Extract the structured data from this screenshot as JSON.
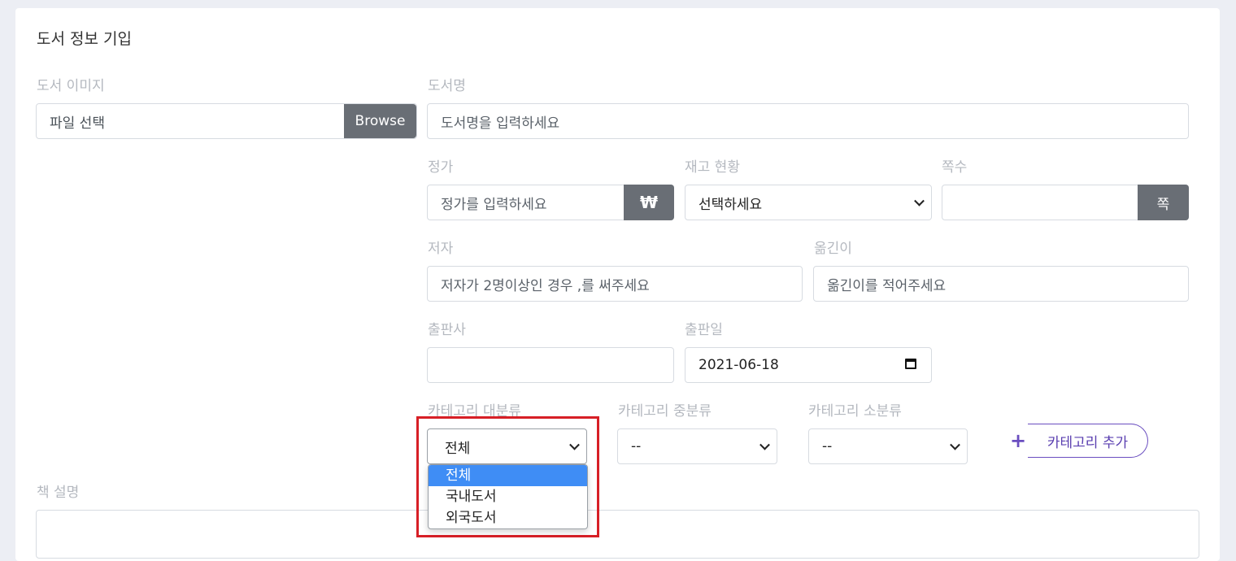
{
  "form": {
    "title": "도서 정보 기입",
    "image": {
      "label": "도서 이미지",
      "value": "파일 선택",
      "button": "Browse"
    },
    "book_name": {
      "label": "도서명",
      "placeholder": "도서명을 입력하세요"
    },
    "price": {
      "label": "정가",
      "placeholder": "정가를 입력하세요",
      "addon": "₩"
    },
    "stock": {
      "label": "재고 현황",
      "selected": "선택하세요"
    },
    "pages": {
      "label": "쪽수",
      "value": "",
      "addon": "쪽"
    },
    "author": {
      "label": "저자",
      "placeholder": "저자가 2명이상인 경우 ,를 써주세요"
    },
    "translator": {
      "label": "옮긴이",
      "placeholder": "옮긴이를 적어주세요"
    },
    "publisher": {
      "label": "출판사",
      "value": ""
    },
    "pub_date": {
      "label": "출판일",
      "value": "2021-06-18"
    },
    "category_major": {
      "label": "카테고리 대분류",
      "selected": "전체",
      "options": [
        "전체",
        "국내도서",
        "외국도서"
      ]
    },
    "category_middle": {
      "label": "카테고리 중분류",
      "selected": "--"
    },
    "category_minor": {
      "label": "카테고리 소분류",
      "selected": "--"
    },
    "add_category_button": "카테고리 추가",
    "description": {
      "label": "책 설명"
    }
  },
  "icons": {
    "add": "plus-icon",
    "dropdown": "chevron-down-icon",
    "calendar": "calendar-icon"
  },
  "colors": {
    "highlight": "#d71f26",
    "selected_option": "#3f8df5",
    "accent": "#6a4ec0",
    "addon": "#696e75"
  }
}
